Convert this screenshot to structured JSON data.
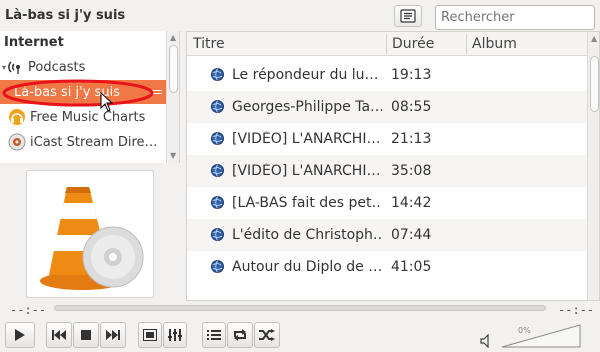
{
  "header": {
    "title": "Là-bas si j'y suis",
    "search_placeholder": "Rechercher"
  },
  "sidebar": {
    "section": "Internet",
    "items": [
      {
        "label": "Podcasts",
        "icon": "podcast-icon",
        "selected": false
      },
      {
        "label": "Là-bas si j'y suis",
        "icon": "",
        "selected": true
      },
      {
        "label": "Free Music Charts",
        "icon": "headphones-icon",
        "selected": false
      },
      {
        "label": "iCast Stream Dire…",
        "icon": "icast-icon",
        "selected": false
      }
    ]
  },
  "playlist": {
    "columns": [
      "Titre",
      "Durée",
      "Album"
    ],
    "rows": [
      {
        "title": "Le répondeur du lu…",
        "duration": "19:13"
      },
      {
        "title": "Georges-Philippe Ta…",
        "duration": "08:55"
      },
      {
        "title": "[VIDÉO] L'ANARCHI…",
        "duration": "21:13"
      },
      {
        "title": "[VIDÉO] L'ANARCHI…",
        "duration": "35:08"
      },
      {
        "title": "[LÀ-BAS fait des pet…",
        "duration": "14:42"
      },
      {
        "title": "L'édito de Christoph…",
        "duration": "07:44"
      },
      {
        "title": "Autour du Diplo de …",
        "duration": "41:05"
      }
    ]
  },
  "player": {
    "elapsed": "--:--",
    "remaining": "--:--",
    "volume": "0%"
  },
  "colors": {
    "selection": "#f07746",
    "annotation": "#e8121b"
  }
}
